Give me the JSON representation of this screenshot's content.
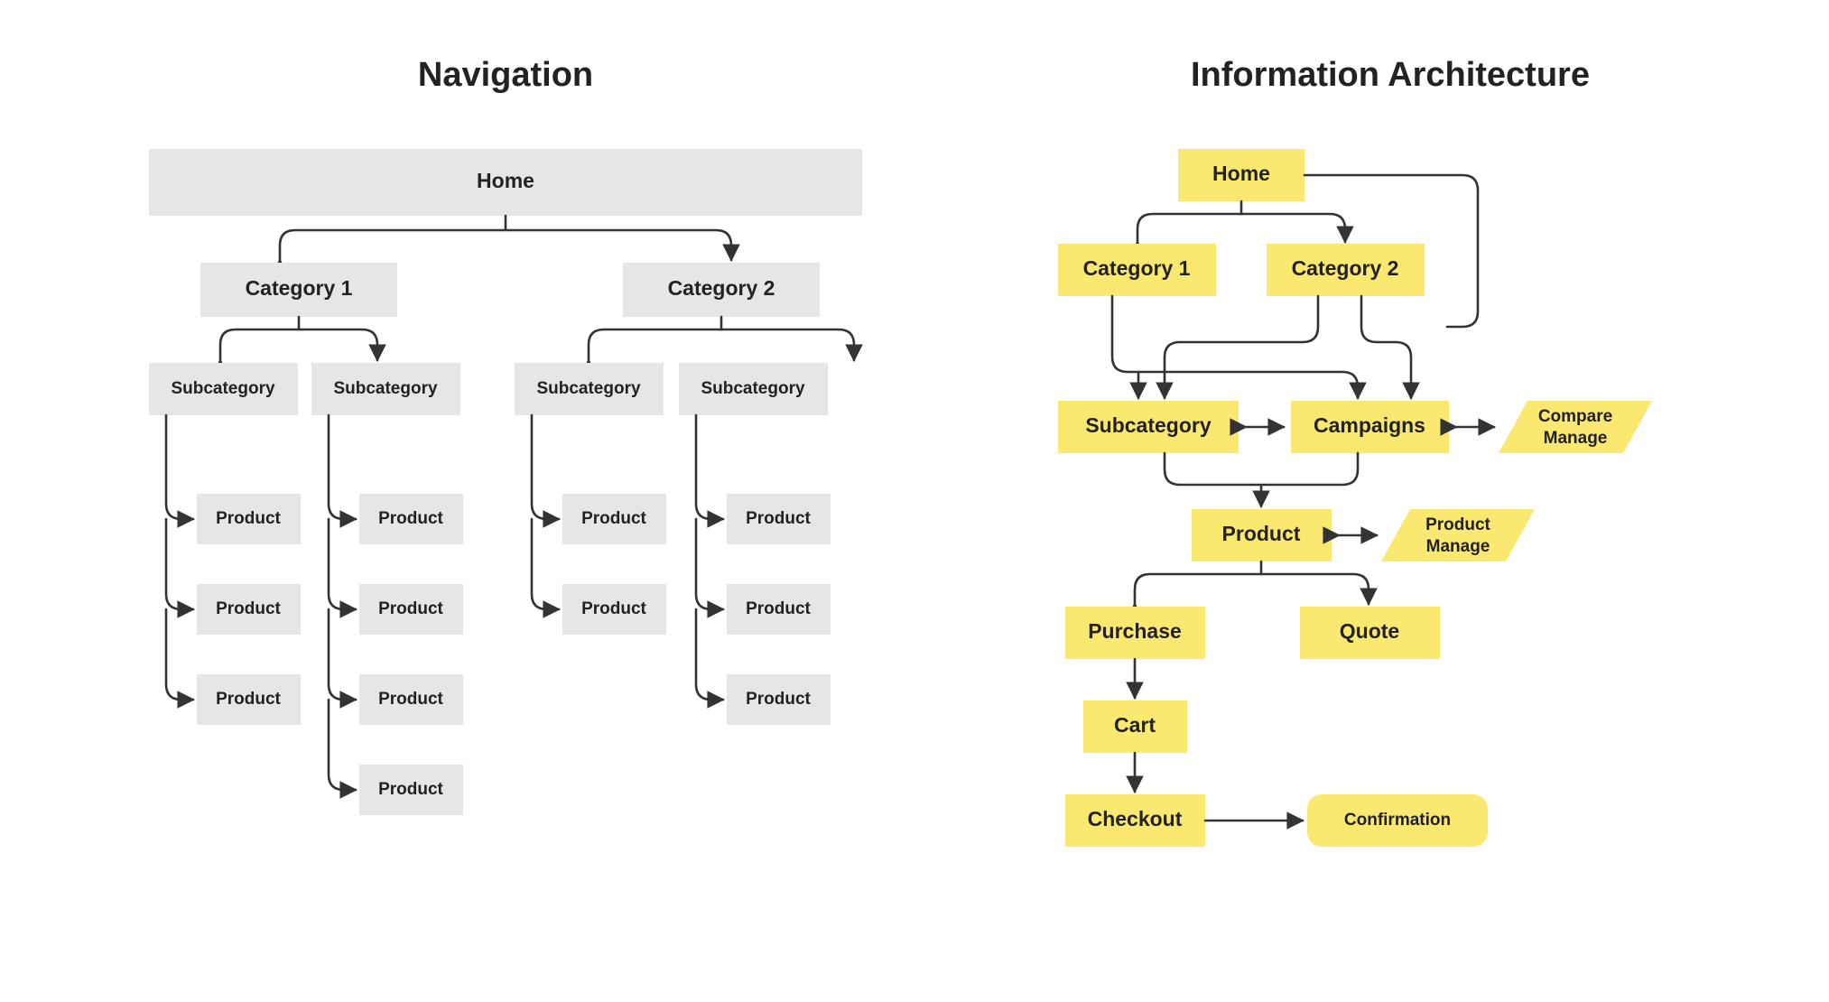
{
  "titles": {
    "left": "Navigation",
    "right": "Information Architecture"
  },
  "nav": {
    "home": "Home",
    "cat1": "Category 1",
    "cat2": "Category 2",
    "sub": "Subcategory",
    "prod": "Product"
  },
  "ia": {
    "home": "Home",
    "cat1": "Category 1",
    "cat2": "Category 2",
    "sub": "Subcategory",
    "camp": "Campaigns",
    "cmp1": "Compare",
    "cmp2": "Manage",
    "prod": "Product",
    "pm1": "Product",
    "pm2": "Manage",
    "purchase": "Purchase",
    "quote": "Quote",
    "cart": "Cart",
    "checkout": "Checkout",
    "confirm": "Confirmation"
  }
}
